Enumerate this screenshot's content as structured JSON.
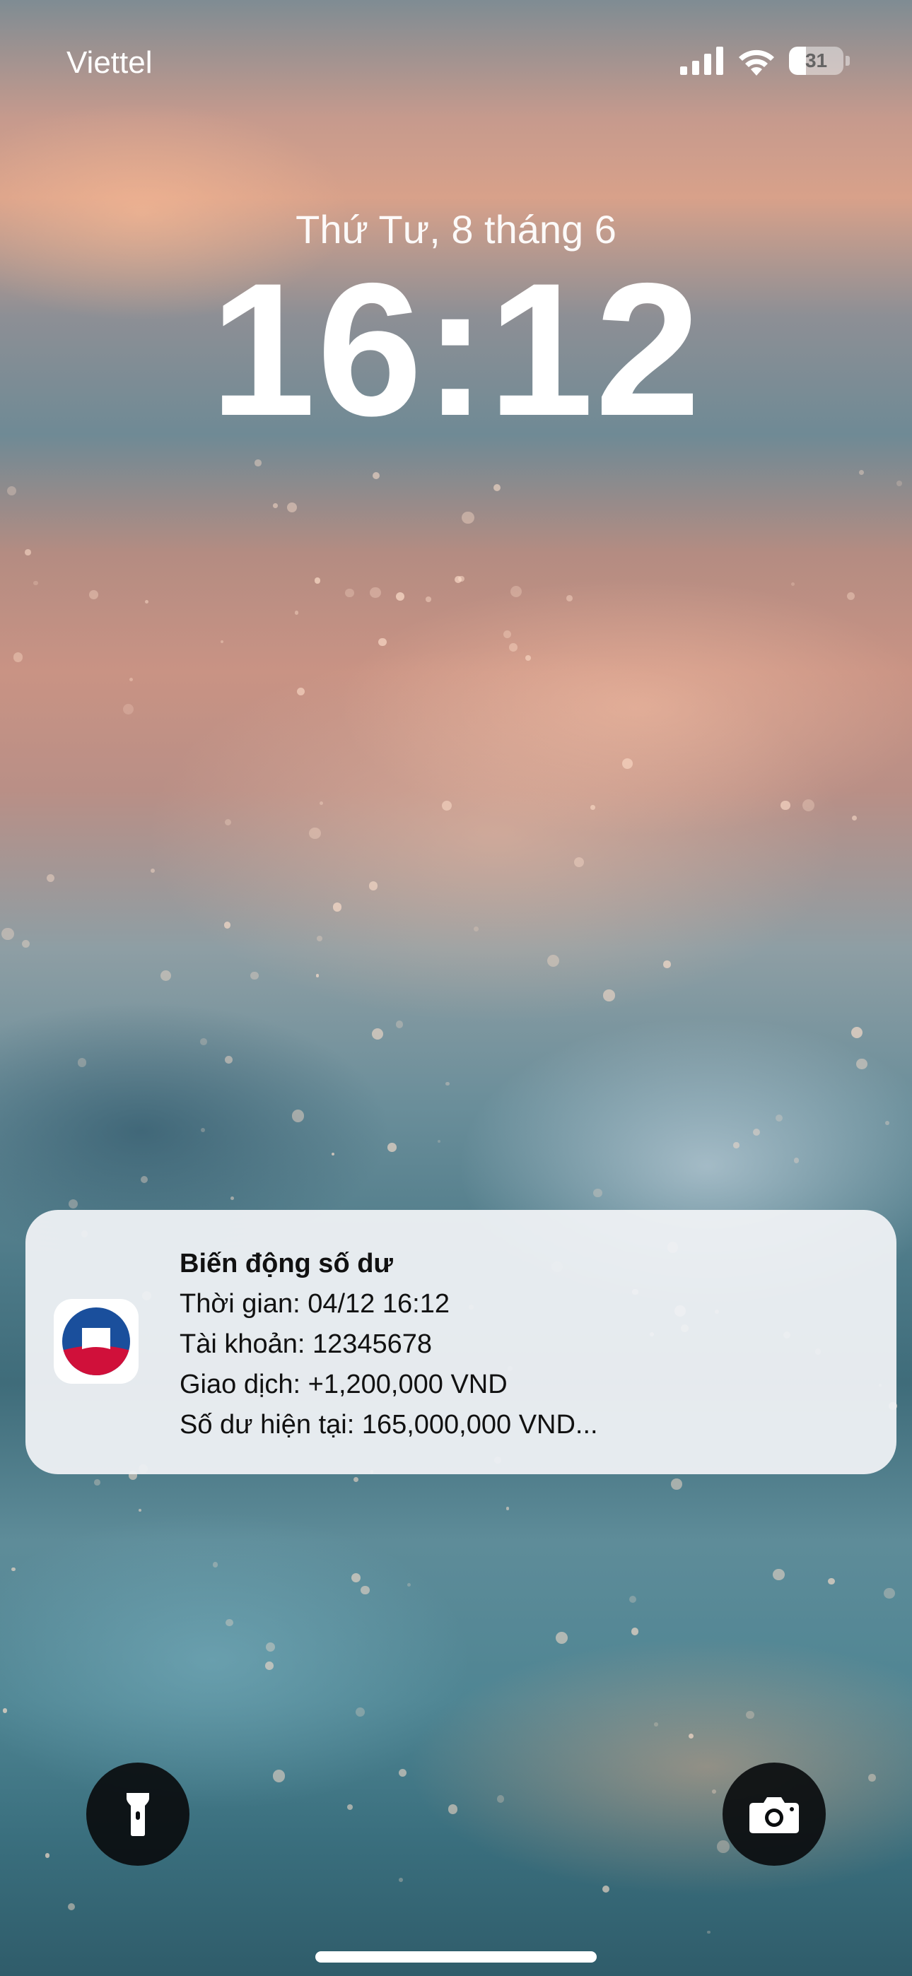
{
  "status_bar": {
    "carrier": "Viettel",
    "battery_level": "31",
    "battery_fraction": 0.31,
    "icons": [
      "cellular-signal-icon",
      "wifi-icon",
      "battery-icon"
    ]
  },
  "lock_screen": {
    "date": "Thứ Tư, 8 tháng 6",
    "time": "16:12"
  },
  "notification": {
    "app_icon": "bank-logo-icon",
    "title": "Biến động số dư",
    "lines": [
      "Thời gian: 04/12 16:12",
      "Tài khoản: 12345678",
      "Giao dịch: +1,200,000 VND",
      "Số dư hiện tại: 165,000,000 VND..."
    ]
  },
  "quick_actions": {
    "left": "flashlight-icon",
    "right": "camera-icon"
  },
  "colors": {
    "notification_bg": "#f0f2f5",
    "logo_blue": "#1a4f9c",
    "logo_red": "#d0103a",
    "quick_button_bg": "#0a0c0e"
  }
}
